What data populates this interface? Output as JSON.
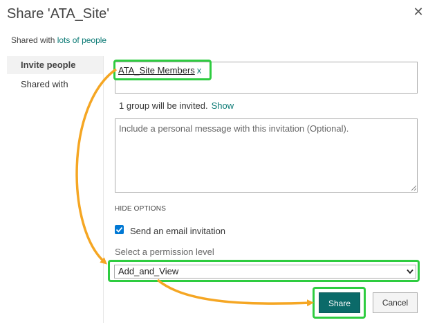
{
  "dialog": {
    "title": "Share 'ATA_Site'",
    "close_glyph": "✕"
  },
  "shared_with": {
    "prefix": "Shared with",
    "link": "lots of people"
  },
  "sidebar": {
    "items": [
      {
        "label": "Invite people",
        "active": true
      },
      {
        "label": "Shared with",
        "active": false
      }
    ]
  },
  "invite": {
    "recipient_name": "ATA_Site Members",
    "remove_glyph": "x",
    "invited_text": "1 group will be invited.",
    "show_link": "Show"
  },
  "message": {
    "placeholder": "Include a personal message with this invitation (Optional).",
    "value": ""
  },
  "options": {
    "toggle_label": "HIDE OPTIONS",
    "send_email_label": "Send an email invitation",
    "send_email_checked": true,
    "permission_label": "Select a permission level",
    "permission_value": "Add_and_View"
  },
  "buttons": {
    "share": "Share",
    "cancel": "Cancel"
  },
  "colors": {
    "accent": "#0b6a69",
    "link": "#0b7a75",
    "highlight": "#2ecc40",
    "annotation_arrow": "#f5a623",
    "checkbox": "#0078d4"
  }
}
